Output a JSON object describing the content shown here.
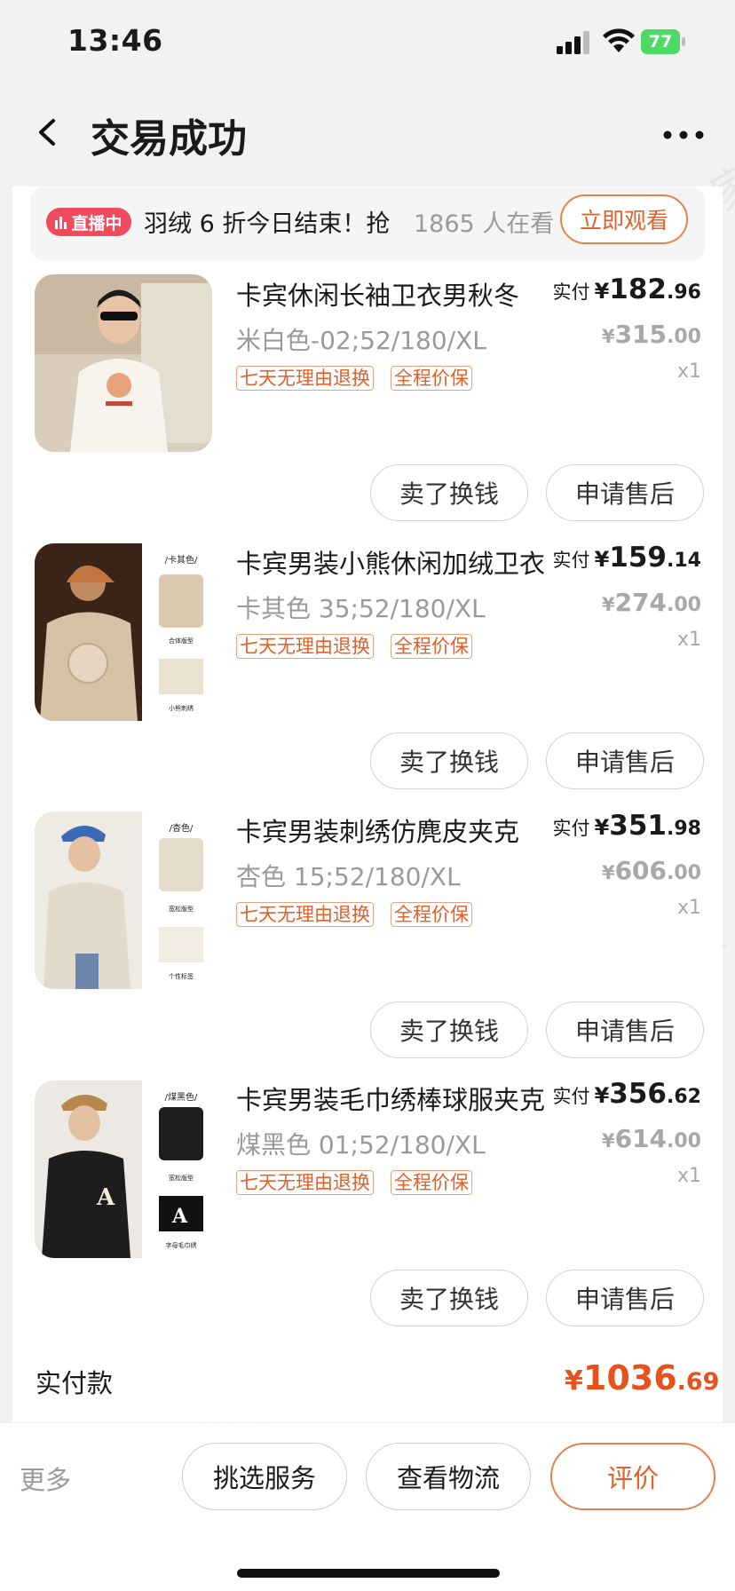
{
  "status": {
    "time": "13:46",
    "battery": "77"
  },
  "nav": {
    "title": "交易成功"
  },
  "live": {
    "badge": "直播中",
    "text": "羽绒 6 折今日结束！抢",
    "count": "1865 人在看",
    "button": "立即观看"
  },
  "items": [
    {
      "title": "卡宾休闲长袖卫衣男秋冬",
      "spec": "米白色-02;52/180/XL",
      "tags": [
        "七天无理由退换",
        "全程价保"
      ],
      "paid_label": "实付",
      "yen": "¥",
      "paid_int": "182",
      "paid_dec": ".96",
      "orig_int": "315",
      "orig_dec": ".00",
      "qty": "x1",
      "btn_sell": "卖了换钱",
      "btn_after": "申请售后"
    },
    {
      "title": "卡宾男装小熊休闲加绒卫衣",
      "spec": "卡其色 35;52/180/XL",
      "tags": [
        "七天无理由退换",
        "全程价保"
      ],
      "paid_label": "实付",
      "yen": "¥",
      "paid_int": "159",
      "paid_dec": ".14",
      "orig_int": "274",
      "orig_dec": ".00",
      "qty": "x1",
      "btn_sell": "卖了换钱",
      "btn_after": "申请售后"
    },
    {
      "title": "卡宾男装刺绣仿麂皮夹克",
      "spec": "杏色 15;52/180/XL",
      "tags": [
        "七天无理由退换",
        "全程价保"
      ],
      "paid_label": "实付",
      "yen": "¥",
      "paid_int": "351",
      "paid_dec": ".98",
      "orig_int": "606",
      "orig_dec": ".00",
      "qty": "x1",
      "btn_sell": "卖了换钱",
      "btn_after": "申请售后"
    },
    {
      "title": "卡宾男装毛巾绣棒球服夹克",
      "spec": "煤黑色 01;52/180/XL",
      "tags": [
        "七天无理由退换",
        "全程价保"
      ],
      "paid_label": "实付",
      "yen": "¥",
      "paid_int": "356",
      "paid_dec": ".62",
      "orig_int": "614",
      "orig_dec": ".00",
      "qty": "x1",
      "btn_sell": "卖了换钱",
      "btn_after": "申请售后"
    }
  ],
  "thumb_captions": {
    "item2": [
      "/卡其色/",
      "合体版型",
      "小熊刺绣"
    ],
    "item3": [
      "/杏色/",
      "宽松版型",
      "个性标签"
    ],
    "item4": [
      "/煤黑色/",
      "宽松版型",
      "字母毛巾绣"
    ]
  },
  "total": {
    "label": "实付款",
    "yen": "¥",
    "int": "1036",
    "dec": ".69"
  },
  "bottom": {
    "more": "更多",
    "btn1": "挑选服务",
    "btn2": "查看物流",
    "btn3": "评价"
  },
  "watermark": "您身边的消费服务管家 消费保",
  "colors": {
    "accent": "#e2602a",
    "live_badge": "#ef4a5d",
    "total": "#e8501c"
  }
}
